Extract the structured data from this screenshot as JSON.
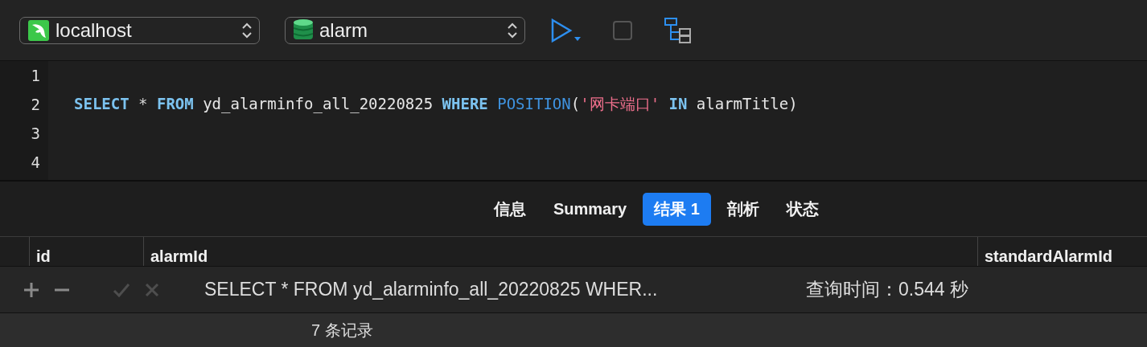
{
  "toolbar": {
    "connection": {
      "value": "localhost"
    },
    "database": {
      "value": "alarm"
    }
  },
  "editor": {
    "lines": [
      {
        "number": "1"
      },
      {
        "number": "2",
        "tokens": [
          {
            "kind": "keyword",
            "text": "SELECT"
          },
          {
            "kind": "operator",
            "text": " * "
          },
          {
            "kind": "keyword",
            "text": "FROM"
          },
          {
            "kind": "plain",
            "text": " yd_alarminfo_all_20220825 "
          },
          {
            "kind": "keyword",
            "text": "WHERE "
          },
          {
            "kind": "function",
            "text": "POSITION"
          },
          {
            "kind": "plain",
            "text": "("
          },
          {
            "kind": "string",
            "text": "'网卡端口'"
          },
          {
            "kind": "keyword",
            "text": " IN"
          },
          {
            "kind": "plain",
            "text": " alarmTitle)"
          }
        ]
      },
      {
        "number": "3"
      },
      {
        "number": "4"
      }
    ]
  },
  "tabs": [
    {
      "label": "信息",
      "selected": false
    },
    {
      "label": "Summary",
      "selected": false
    },
    {
      "label": "结果 1",
      "selected": true
    },
    {
      "label": "剖析",
      "selected": false
    },
    {
      "label": "状态",
      "selected": false
    }
  ],
  "table": {
    "columns": [
      "id",
      "alarmId",
      "standardAlarmId"
    ]
  },
  "bottom_toolbar": {
    "buttons": [
      {
        "kind": "add",
        "disabled": false
      },
      {
        "kind": "remove",
        "disabled": false
      },
      {
        "kind": "apply",
        "disabled": true
      },
      {
        "kind": "discard",
        "disabled": true
      }
    ],
    "query": "SELECT * FROM yd_alarminfo_all_20220825 WHER...",
    "query_time": "查询时间：0.544 秒"
  },
  "status_bar": {
    "records": "7 条记录"
  }
}
